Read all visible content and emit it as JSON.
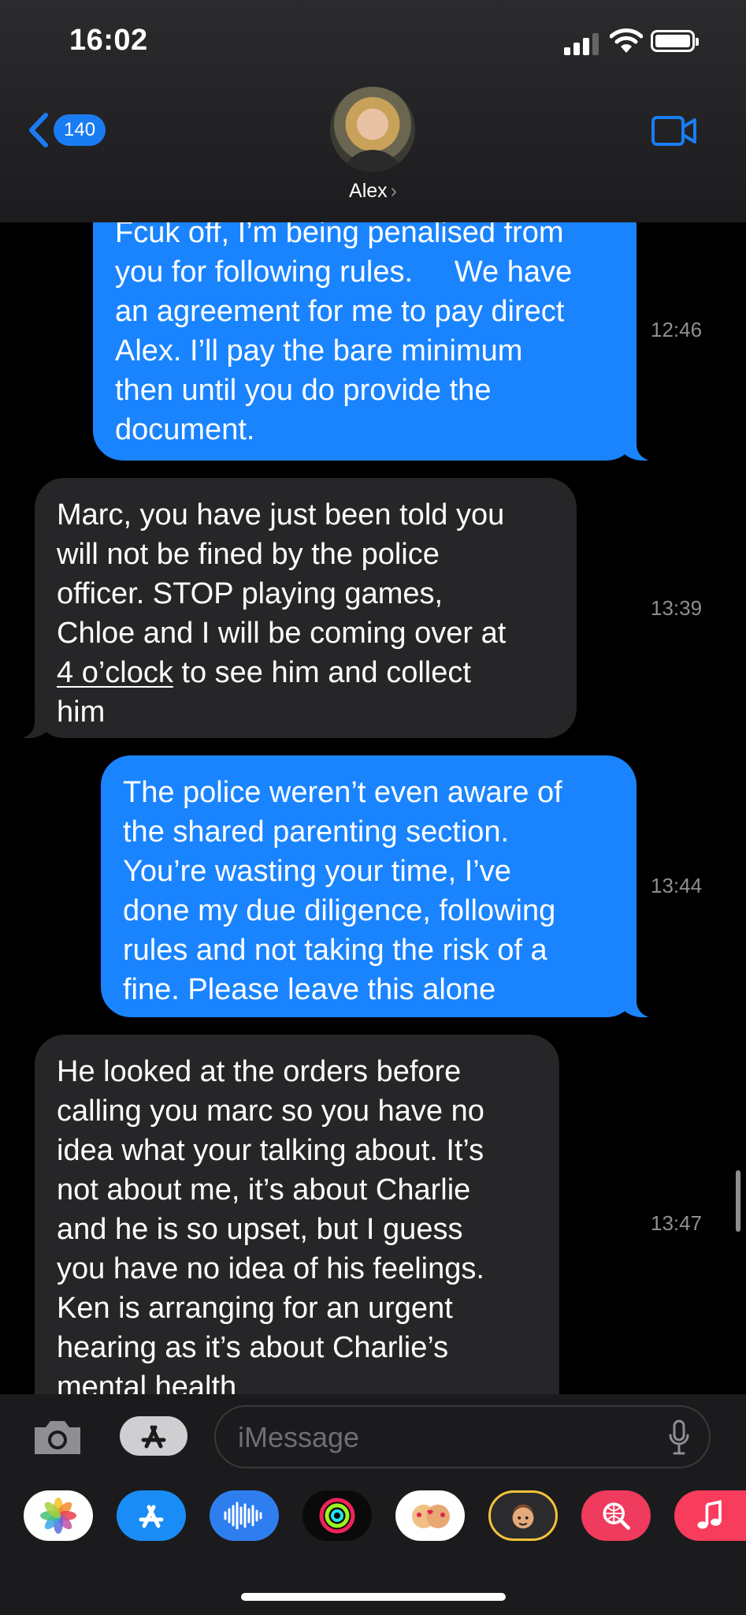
{
  "status_bar": {
    "time": "16:02"
  },
  "header": {
    "back_count": "140",
    "contact_name": "Alex"
  },
  "messages": [
    {
      "lines": [
        "Fcuk off, I’m being penalised from",
        "you for following rules.     We have",
        "an agreement for me to pay direct",
        "Alex. I’ll pay the bare minimum",
        "then until you do provide the",
        "document."
      ],
      "time": "12:46"
    },
    {
      "l1": "Marc, you have just been told you",
      "l2": "will not be fined by the police",
      "l3": "officer. STOP playing games,",
      "l4": "Chloe and I will be coming over at",
      "l5_link": "4 o’clock",
      "l5_rest": " to see him and collect",
      "l6": "him",
      "time": "13:39"
    },
    {
      "lines": [
        "The police weren’t even aware of",
        "the shared parenting section.",
        "You’re wasting your time, I’ve",
        "done my due diligence, following",
        "rules and not taking the risk of a",
        "fine. Please leave this alone"
      ],
      "time": "13:44"
    },
    {
      "lines": [
        "He looked at the orders before",
        "calling you marc so you have no",
        "idea what your talking about. It’s",
        "not about me, it’s about Charlie",
        "and he is so upset, but I guess",
        "you have no idea of his feelings.",
        "Ken is arranging for an urgent",
        "hearing as it’s about Charlie’s",
        "mental health"
      ],
      "time": "13:47"
    }
  ],
  "input": {
    "placeholder": "iMessage"
  },
  "app_drawer": [
    "photos-icon",
    "app-store-icon",
    "audio-message-icon",
    "activity-icon",
    "memoji-stickers-icon",
    "memoji-icon",
    "web-search-icon",
    "music-icon"
  ],
  "colors": {
    "sent_bubble": "#1a84ff",
    "received_bubble": "#262628",
    "accent": "#1a7cf3"
  }
}
